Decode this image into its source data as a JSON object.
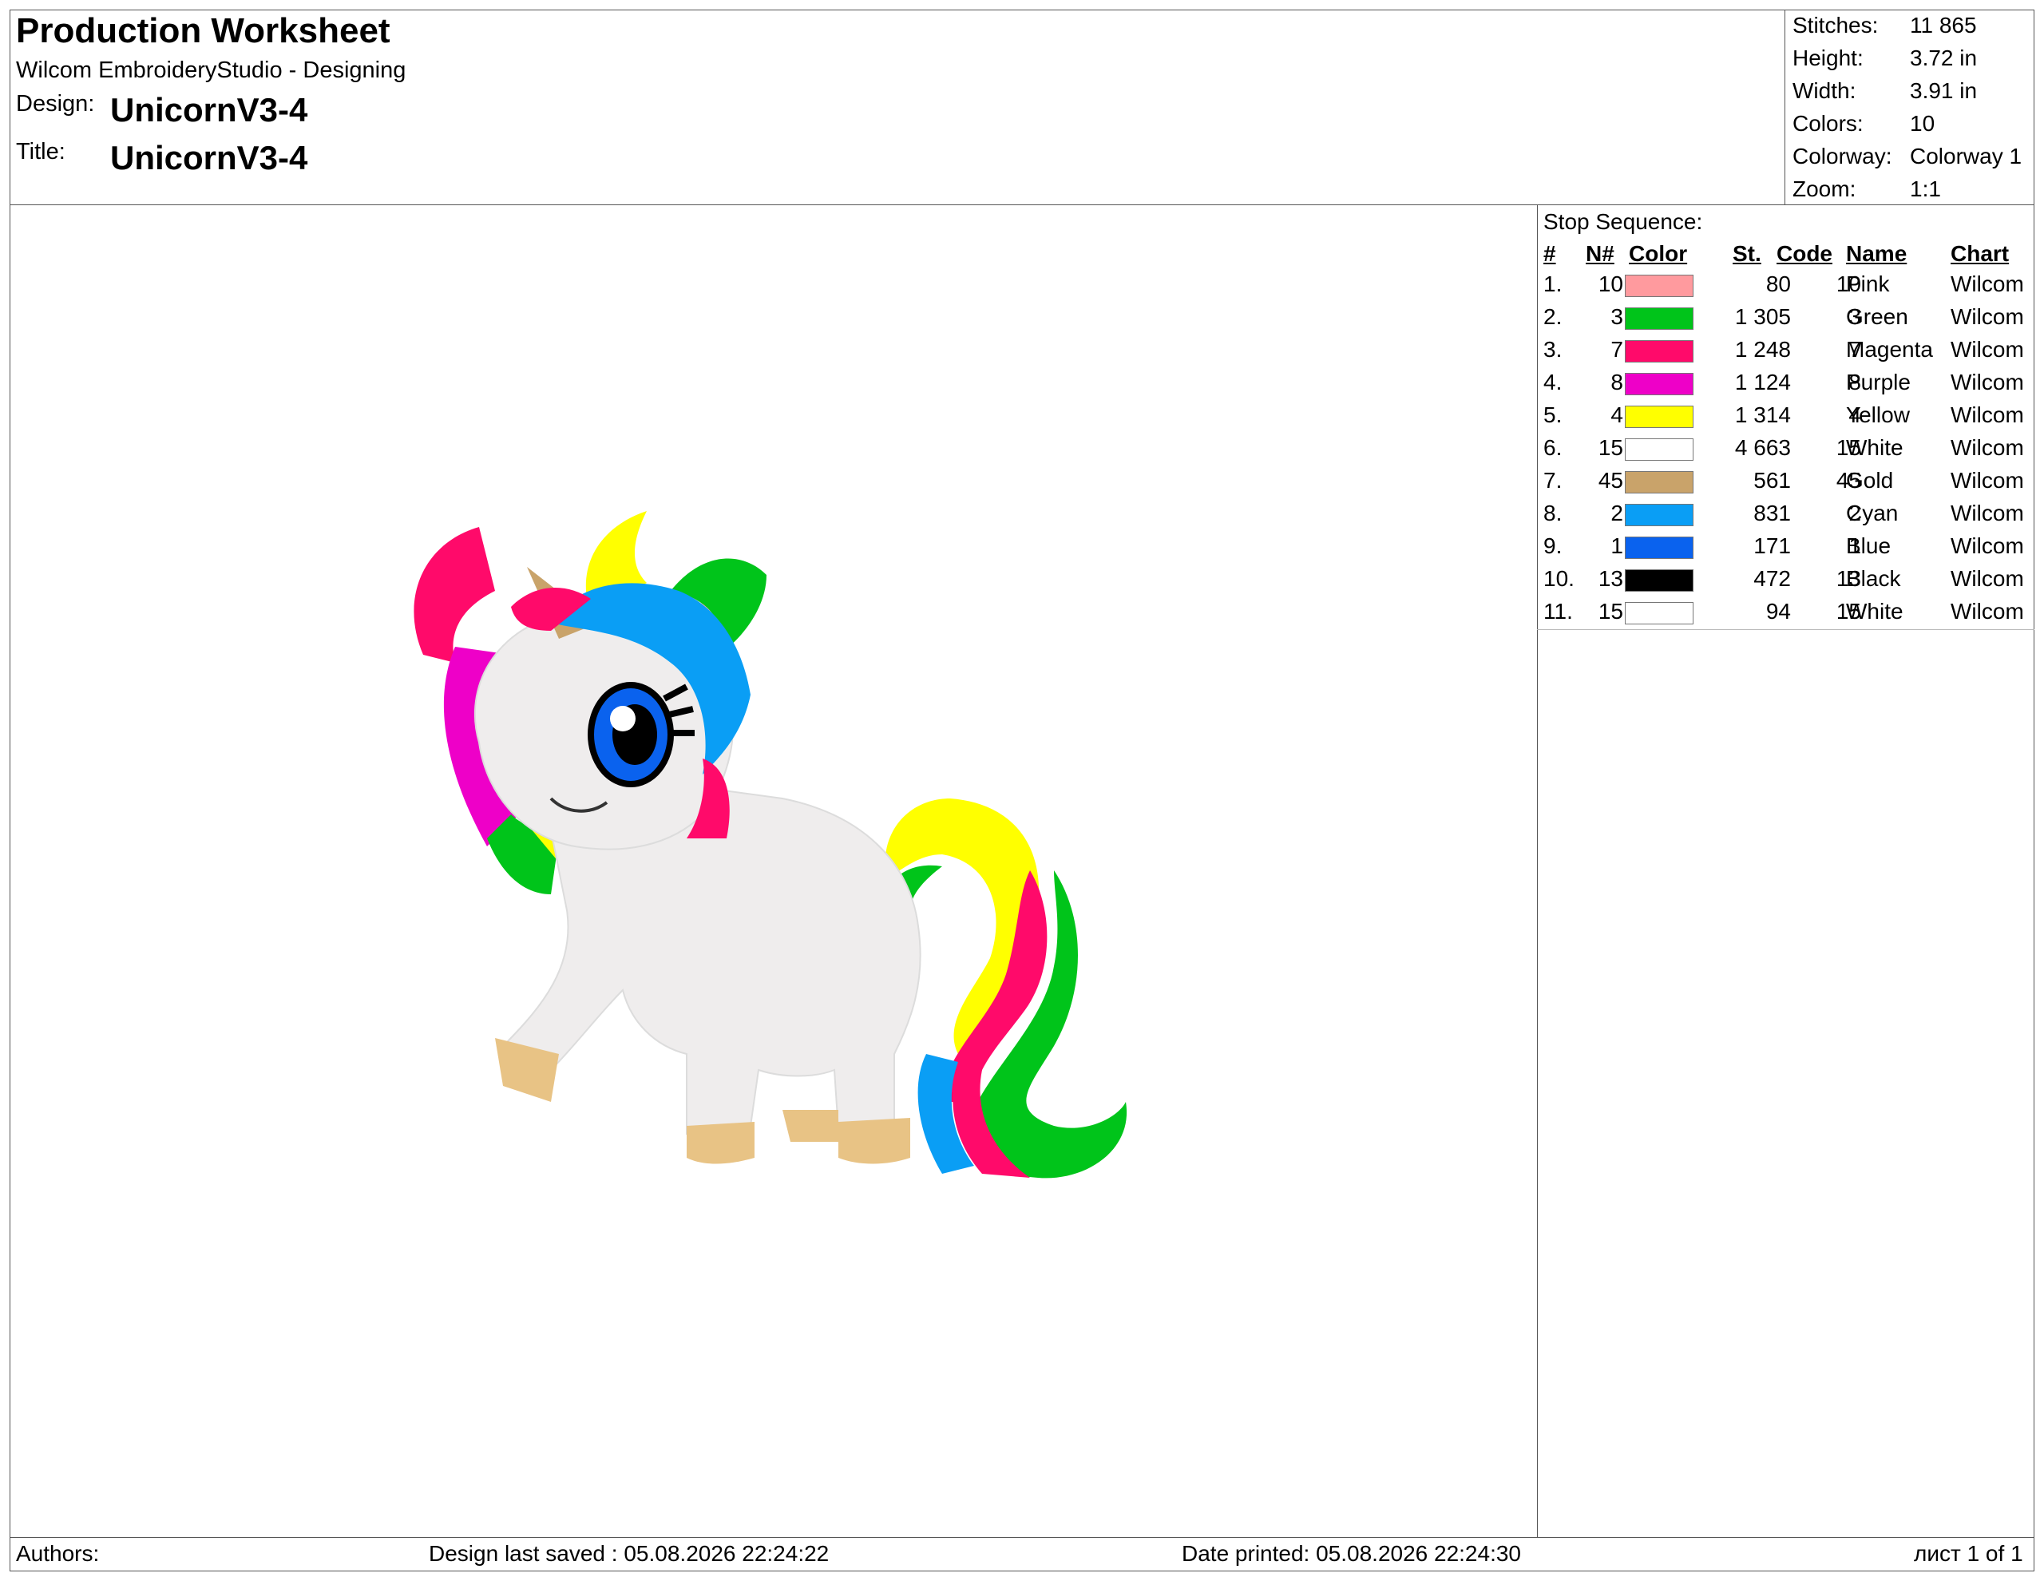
{
  "header": {
    "title": "Production Worksheet",
    "subtitle": "Wilcom EmbroideryStudio - Designing",
    "design_label": "Design:",
    "design_value": "UnicornV3-4",
    "title_label": "Title:",
    "title_value": "UnicornV3-4"
  },
  "stats": [
    {
      "label": "Stitches:",
      "value": "11 865"
    },
    {
      "label": "Height:",
      "value": "3.72 in"
    },
    {
      "label": "Width:",
      "value": "3.91 in"
    },
    {
      "label": "Colors:",
      "value": "10"
    },
    {
      "label": "Colorway:",
      "value": "Colorway 1"
    },
    {
      "label": "Zoom:",
      "value": "1:1"
    }
  ],
  "stop_sequence": {
    "title": "Stop Sequence:",
    "headers": {
      "idx": "#",
      "n": "N#",
      "color": "Color",
      "st": "St.",
      "code": "Code",
      "name": "Name",
      "chart": "Chart"
    },
    "rows": [
      {
        "idx": "1.",
        "n": "10",
        "color": "#ff9a9e",
        "st": "80",
        "code": "10",
        "name": "Pink",
        "chart": "Wilcom"
      },
      {
        "idx": "2.",
        "n": "3",
        "color": "#00c41a",
        "st": "1 305",
        "code": "3",
        "name": "Green",
        "chart": "Wilcom"
      },
      {
        "idx": "3.",
        "n": "7",
        "color": "#ff0a6a",
        "st": "1 248",
        "code": "7",
        "name": "Magenta",
        "chart": "Wilcom"
      },
      {
        "idx": "4.",
        "n": "8",
        "color": "#ee00c8",
        "st": "1 124",
        "code": "8",
        "name": "Purple",
        "chart": "Wilcom"
      },
      {
        "idx": "5.",
        "n": "4",
        "color": "#ffff00",
        "st": "1 314",
        "code": "4",
        "name": "Yellow",
        "chart": "Wilcom"
      },
      {
        "idx": "6.",
        "n": "15",
        "color": "#ffffff",
        "st": "4 663",
        "code": "15",
        "name": "White",
        "chart": "Wilcom"
      },
      {
        "idx": "7.",
        "n": "45",
        "color": "#c9a36a",
        "st": "561",
        "code": "45",
        "name": "Gold",
        "chart": "Wilcom"
      },
      {
        "idx": "8.",
        "n": "2",
        "color": "#0a9ef5",
        "st": "831",
        "code": "2",
        "name": "Cyan",
        "chart": "Wilcom"
      },
      {
        "idx": "9.",
        "n": "1",
        "color": "#0a62ee",
        "st": "171",
        "code": "1",
        "name": "Blue",
        "chart": "Wilcom"
      },
      {
        "idx": "10.",
        "n": "13",
        "color": "#000000",
        "st": "472",
        "code": "13",
        "name": "Black",
        "chart": "Wilcom"
      },
      {
        "idx": "11.",
        "n": "15",
        "color": "#ffffff",
        "st": "94",
        "code": "15",
        "name": "White",
        "chart": "Wilcom"
      }
    ]
  },
  "footer": {
    "authors": "Authors:",
    "last_saved": "Design last saved : 05.08.2026 22:24:22",
    "printed": "Date printed: 05.08.2026 22:24:30",
    "page": "лист 1 of 1"
  }
}
